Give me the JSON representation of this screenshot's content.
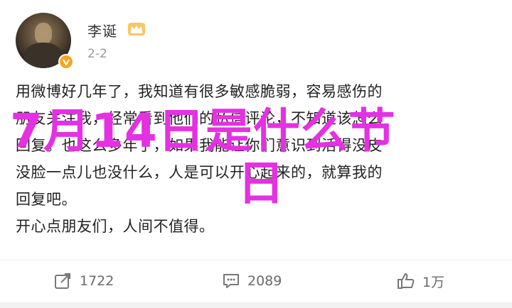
{
  "post": {
    "author": "李诞",
    "date": "2-2",
    "body_lines": [
      "用微博好几年了，我知道有很多敏感脆弱，容易感伤的",
      "朋友关注我，经常看到他们的私信评论，不知道该怎么",
      "回复。也这么多年了，如果我能让你们意识到活得没皮",
      "没脸一点儿也没什么，人是可以开心起来的，就算我的",
      "回复吧。",
      "开心点朋友们，人间不值得。"
    ]
  },
  "overlay": {
    "line1": "7月14日是什么节",
    "line2": "日",
    "color": "#e530e3"
  },
  "actions": {
    "repost_count": "1722",
    "comment_count": "2089",
    "like_count": "1万"
  },
  "icons": {
    "badge": "verified-badge-icon",
    "crown": "crown-icon",
    "repost": "repost-icon",
    "comment": "comment-icon",
    "like": "thumbs-up-icon"
  }
}
